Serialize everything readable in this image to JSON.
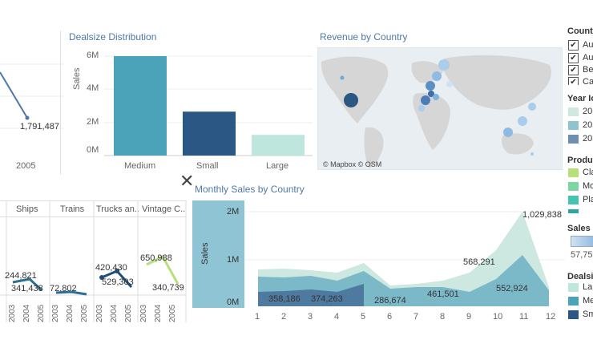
{
  "top_left_partial": {
    "value_label": "1,791,487",
    "axis_year": "2005"
  },
  "dealsize": {
    "title": "Dealsize Distribution",
    "ylabel": "Sales",
    "yticks": [
      "6M",
      "4M",
      "2M",
      "0M"
    ],
    "bars": [
      {
        "label": "Medium",
        "value": 6.0,
        "color": "#4aa3b8"
      },
      {
        "label": "Small",
        "value": 2.65,
        "color": "#2a5783"
      },
      {
        "label": "Large",
        "value": 1.25,
        "color": "#bfe6dd"
      }
    ]
  },
  "map": {
    "title": "Revenue by Country",
    "credit": "© Mapbox © OSM"
  },
  "monthly": {
    "title": "Monthly Sales by Country",
    "ylabel": "Sales",
    "yticks": [
      "2M",
      "1M",
      "0M"
    ],
    "months": [
      "1",
      "2",
      "3",
      "4",
      "5",
      "6",
      "7",
      "8",
      "9",
      "10",
      "11",
      "12"
    ],
    "labels": [
      "358,186",
      "374,263",
      "286,674",
      "461,501",
      "568,291",
      "552,924",
      "1,029,838"
    ]
  },
  "product_lines": {
    "columns": [
      "Ships",
      "Trains",
      "Trucks an..",
      "Vintage C.."
    ],
    "years": [
      "2003",
      "2004",
      "2005"
    ],
    "labels": [
      "244,821",
      "341,438",
      "72,802",
      "420,430",
      "529,303",
      "650,988",
      "340,739"
    ]
  },
  "close_label": "✕",
  "legend": {
    "country_title": "Countr",
    "countries": [
      "Au",
      "Au",
      "Be",
      "Ca"
    ],
    "year_title": "Year Io",
    "years": [
      {
        "label": "20",
        "color": "#cfe8e2"
      },
      {
        "label": "20",
        "color": "#8fc4cf"
      },
      {
        "label": "20",
        "color": "#6e8fb0"
      }
    ],
    "product_title": "Produ",
    "products": [
      {
        "label": "Cla",
        "color": "#b6e07a"
      },
      {
        "label": "Mo",
        "color": "#7fd6a5"
      },
      {
        "label": "Pla",
        "color": "#46c4b0"
      },
      {
        "label": "",
        "color": "#2aa6a6"
      }
    ],
    "sales_title": "Sales",
    "sales_value": "57,75"
  }
}
